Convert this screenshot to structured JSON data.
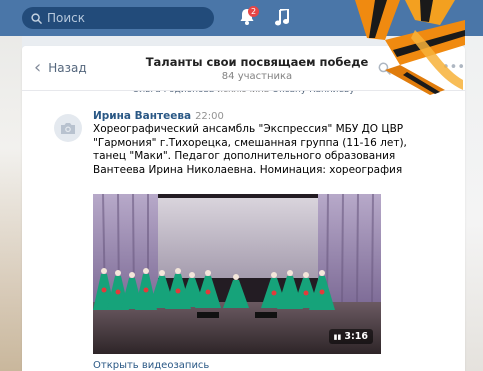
{
  "topbar": {
    "search_placeholder": "Поиск",
    "notifications_count": "2"
  },
  "chat": {
    "back_label": "Назад",
    "title": "Таланты свои посвящаем победе",
    "members": "84 участника",
    "system_message": {
      "actor": "Ольга Родионова",
      "action": " исключила ",
      "target": "Оксану Каплиеву"
    }
  },
  "message": {
    "author": "Ирина Вантеева",
    "time": "22:00",
    "text": "Хореографический ансамбль \"Экспрессия\" МБУ ДО ЦВР \"Гармония\" г.Тихорецка, смешанная группа (11-16 лет), танец \"Маки\". Педагог дополнительного образования Вантеева Ирина Николаевна. Номинация: хореография"
  },
  "video": {
    "duration": "3:16",
    "open_label": "Открыть видеозапись"
  },
  "colors": {
    "topbar": "#4a76a8",
    "link": "#2a5885",
    "badge": "#e64646",
    "ribbon_orange": "#f08a10",
    "ribbon_black": "#1a1a1a"
  }
}
